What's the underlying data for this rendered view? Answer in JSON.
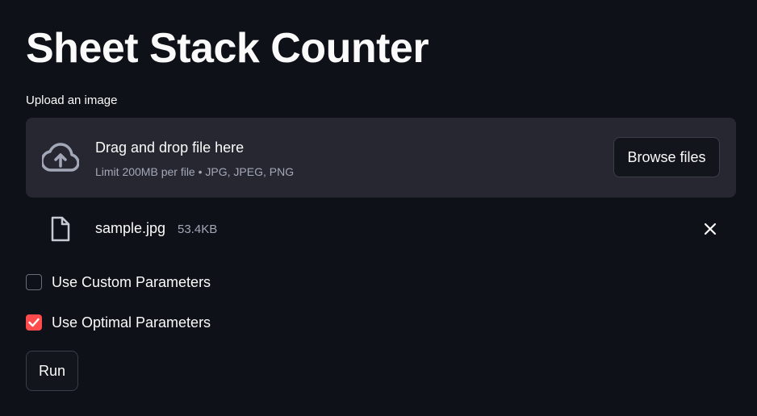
{
  "app": {
    "title": "Sheet Stack Counter"
  },
  "uploader": {
    "label": "Upload an image",
    "drop_text": "Drag and drop file here",
    "limit_text": "Limit 200MB per file • JPG, JPEG, PNG",
    "browse_label": "Browse files",
    "icon": "cloud-upload-icon"
  },
  "uploaded_file": {
    "name": "sample.jpg",
    "size": "53.4KB",
    "icon": "file-icon",
    "remove_icon": "close-icon"
  },
  "options": {
    "custom_params": {
      "label": "Use Custom Parameters",
      "checked": false
    },
    "optimal_params": {
      "label": "Use Optimal Parameters",
      "checked": true
    }
  },
  "actions": {
    "run_label": "Run"
  },
  "colors": {
    "background": "#0e1117",
    "surface": "#262730",
    "accent": "#ff4b4b",
    "muted_text": "#a3a8b8"
  }
}
